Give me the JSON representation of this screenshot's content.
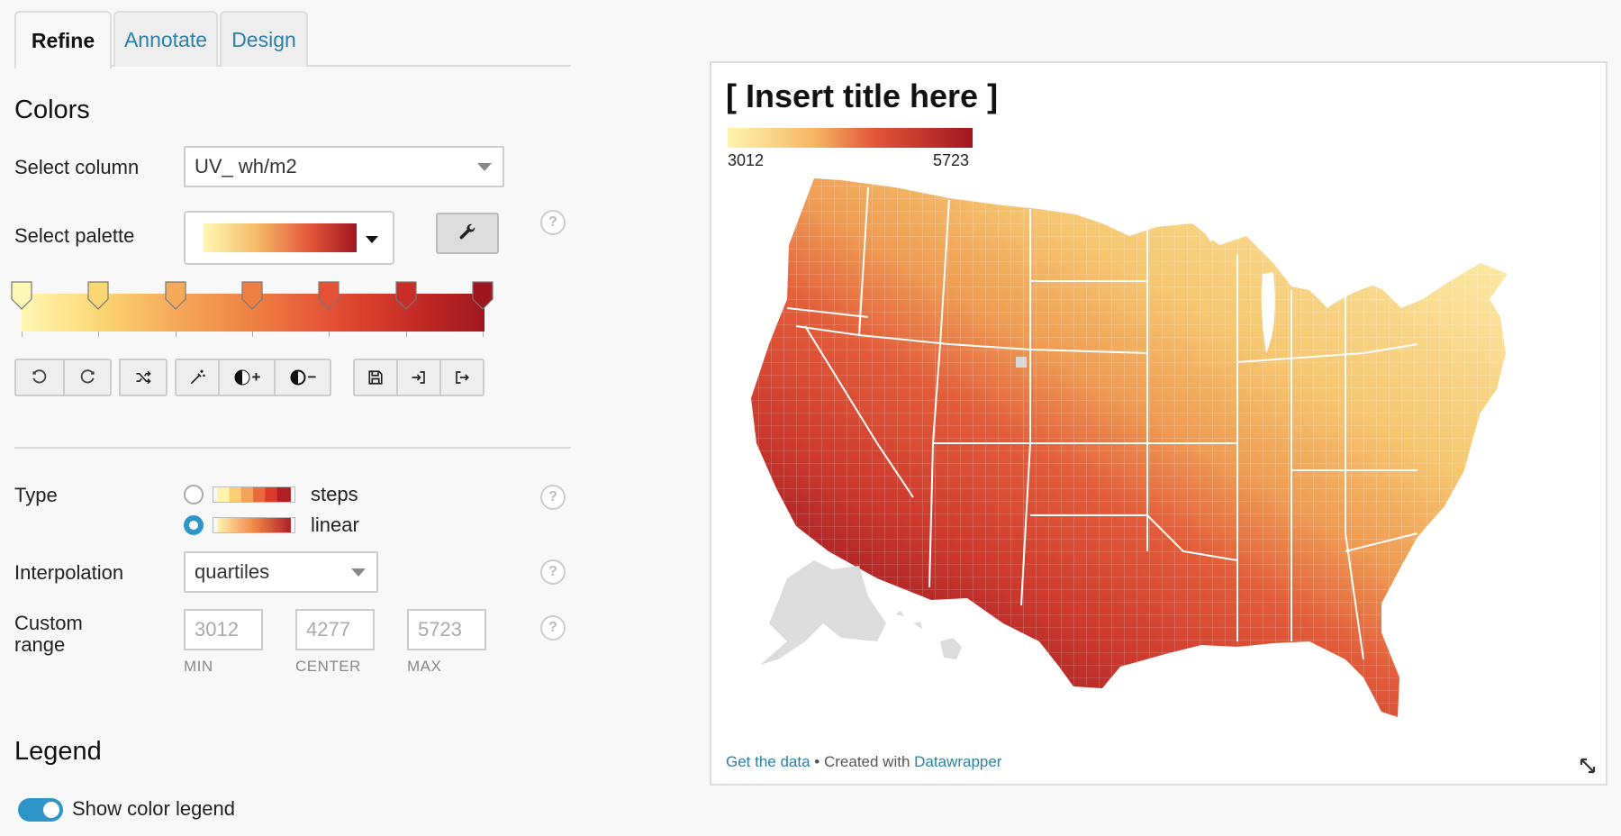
{
  "tabs": [
    {
      "label": "Refine",
      "active": true
    },
    {
      "label": "Annotate",
      "active": false
    },
    {
      "label": "Design",
      "active": false
    }
  ],
  "colors": {
    "heading": "Colors",
    "select_column_label": "Select column",
    "select_column_value": "UV_ wh/m2",
    "select_palette_label": "Select palette",
    "help_glyph": "?",
    "palette_stops": [
      "#fff7b5",
      "#fbd774",
      "#f5a95a",
      "#ee8043",
      "#e45134",
      "#c82e26",
      "#a0161f"
    ],
    "toolbar_icons": [
      "undo-icon",
      "redo-icon",
      "shuffle-icon",
      "magic-wand-icon",
      "contrast-plus-icon",
      "contrast-minus-icon",
      "save-icon",
      "import-icon",
      "export-icon"
    ],
    "contrast_plus": "+",
    "contrast_minus": "−"
  },
  "type": {
    "label": "Type",
    "options": [
      {
        "label": "steps",
        "selected": false
      },
      {
        "label": "linear",
        "selected": true
      }
    ],
    "steps_colors": [
      "#fff3b0",
      "#fbcf76",
      "#f4a35a",
      "#e9683c",
      "#d93b2c",
      "#b11f24"
    ]
  },
  "interpolation": {
    "label": "Interpolation",
    "value": "quartiles"
  },
  "custom_range": {
    "label_line1": "Custom",
    "label_line2": "range",
    "min_placeholder": "3012",
    "center_placeholder": "4277",
    "max_placeholder": "5723",
    "min_caption": "MIN",
    "center_caption": "CENTER",
    "max_caption": "MAX"
  },
  "legend": {
    "heading": "Legend",
    "show_label": "Show color legend",
    "enabled": true
  },
  "preview": {
    "title": "[ Insert title here ]",
    "legend_min": "3012",
    "legend_max": "5723",
    "footer_link1": "Get the data",
    "footer_sep": " • Created with ",
    "footer_link2": "Datawrapper"
  },
  "accent_color": "#2e95c9",
  "link_color": "#2b7fa8"
}
